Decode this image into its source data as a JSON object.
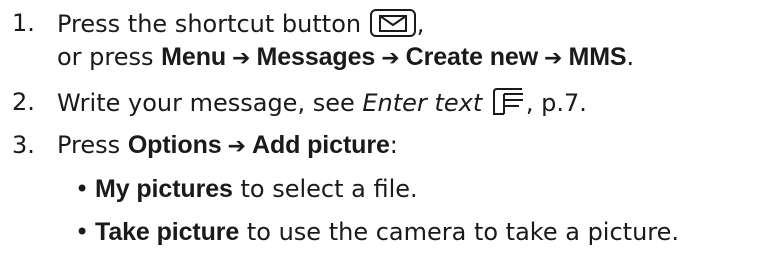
{
  "steps": [
    {
      "number": "1.",
      "line1_text": "Press the shortcut button",
      "line1_tail": ",",
      "line2_prefix": "or press",
      "path": [
        "Menu",
        "Messages",
        "Create new",
        "MMS"
      ],
      "line2_suffix": "."
    },
    {
      "number": "2.",
      "text_before": "Write your message, see",
      "italic_ref": "Enter text",
      "text_after": ", p.7."
    },
    {
      "number": "3.",
      "prefix": "Press",
      "path": [
        "Options",
        "Add picture"
      ],
      "suffix": ":",
      "bullets": [
        {
          "bold": "My pictures",
          "text": " to select a file."
        },
        {
          "bold": "Take picture",
          "text": " to use the camera to take a picture."
        }
      ]
    }
  ],
  "arrow_glyph": "➔",
  "bullet_glyph": "•",
  "icons": {
    "shortcut": "envelope-key-icon",
    "reference": "pointing-hand-icon"
  }
}
